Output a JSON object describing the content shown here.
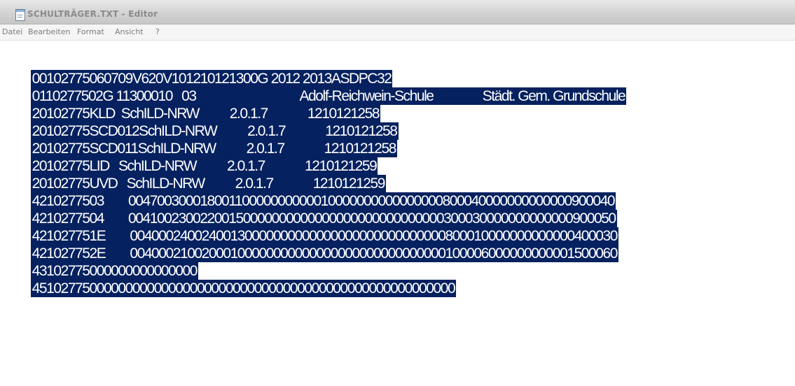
{
  "window": {
    "title": "SCHULTRÄGER.TXT - Editor"
  },
  "menubar": {
    "items": [
      "Datei",
      "Bearbeiten",
      "Format",
      "Ansicht",
      "?"
    ]
  },
  "editor": {
    "selection_color": "#06215f",
    "lines": [
      "00102775060709V620V101210121300G 2012 2013ASDPC32",
      "0110277502G 11300010   03                                  Adolf-Reichwein-Schule                Städt. Gem. Grundschule",
      "20102775KLD  SchILD-NRW          2.0.1.7             1210121258",
      "20102775SCD012SchILD-NRW          2.0.1.7             1210121258",
      "20102775SCD011SchILD-NRW          2.0.1.7             1210121258",
      "20102775LID   SchILD-NRW          2.0.1.7             1210121259",
      "20102775UVD   SchILD-NRW          2.0.1.7             1210121259",
      "4210277503        00470030001800110000000000010000000000000000800040000000000000900040",
      "4210277504        00410023002200150000000000000000000000000000300030000000000000900050",
      "421027751E        00400024002400130000000000000000000000000000800010000000000000400030",
      "421027752E        00400021002000100000000000000000000000000000100006000000000001500060",
      "43102775000000000000000",
      "45102775000000000000000000000000000000000000000000000000000"
    ]
  }
}
